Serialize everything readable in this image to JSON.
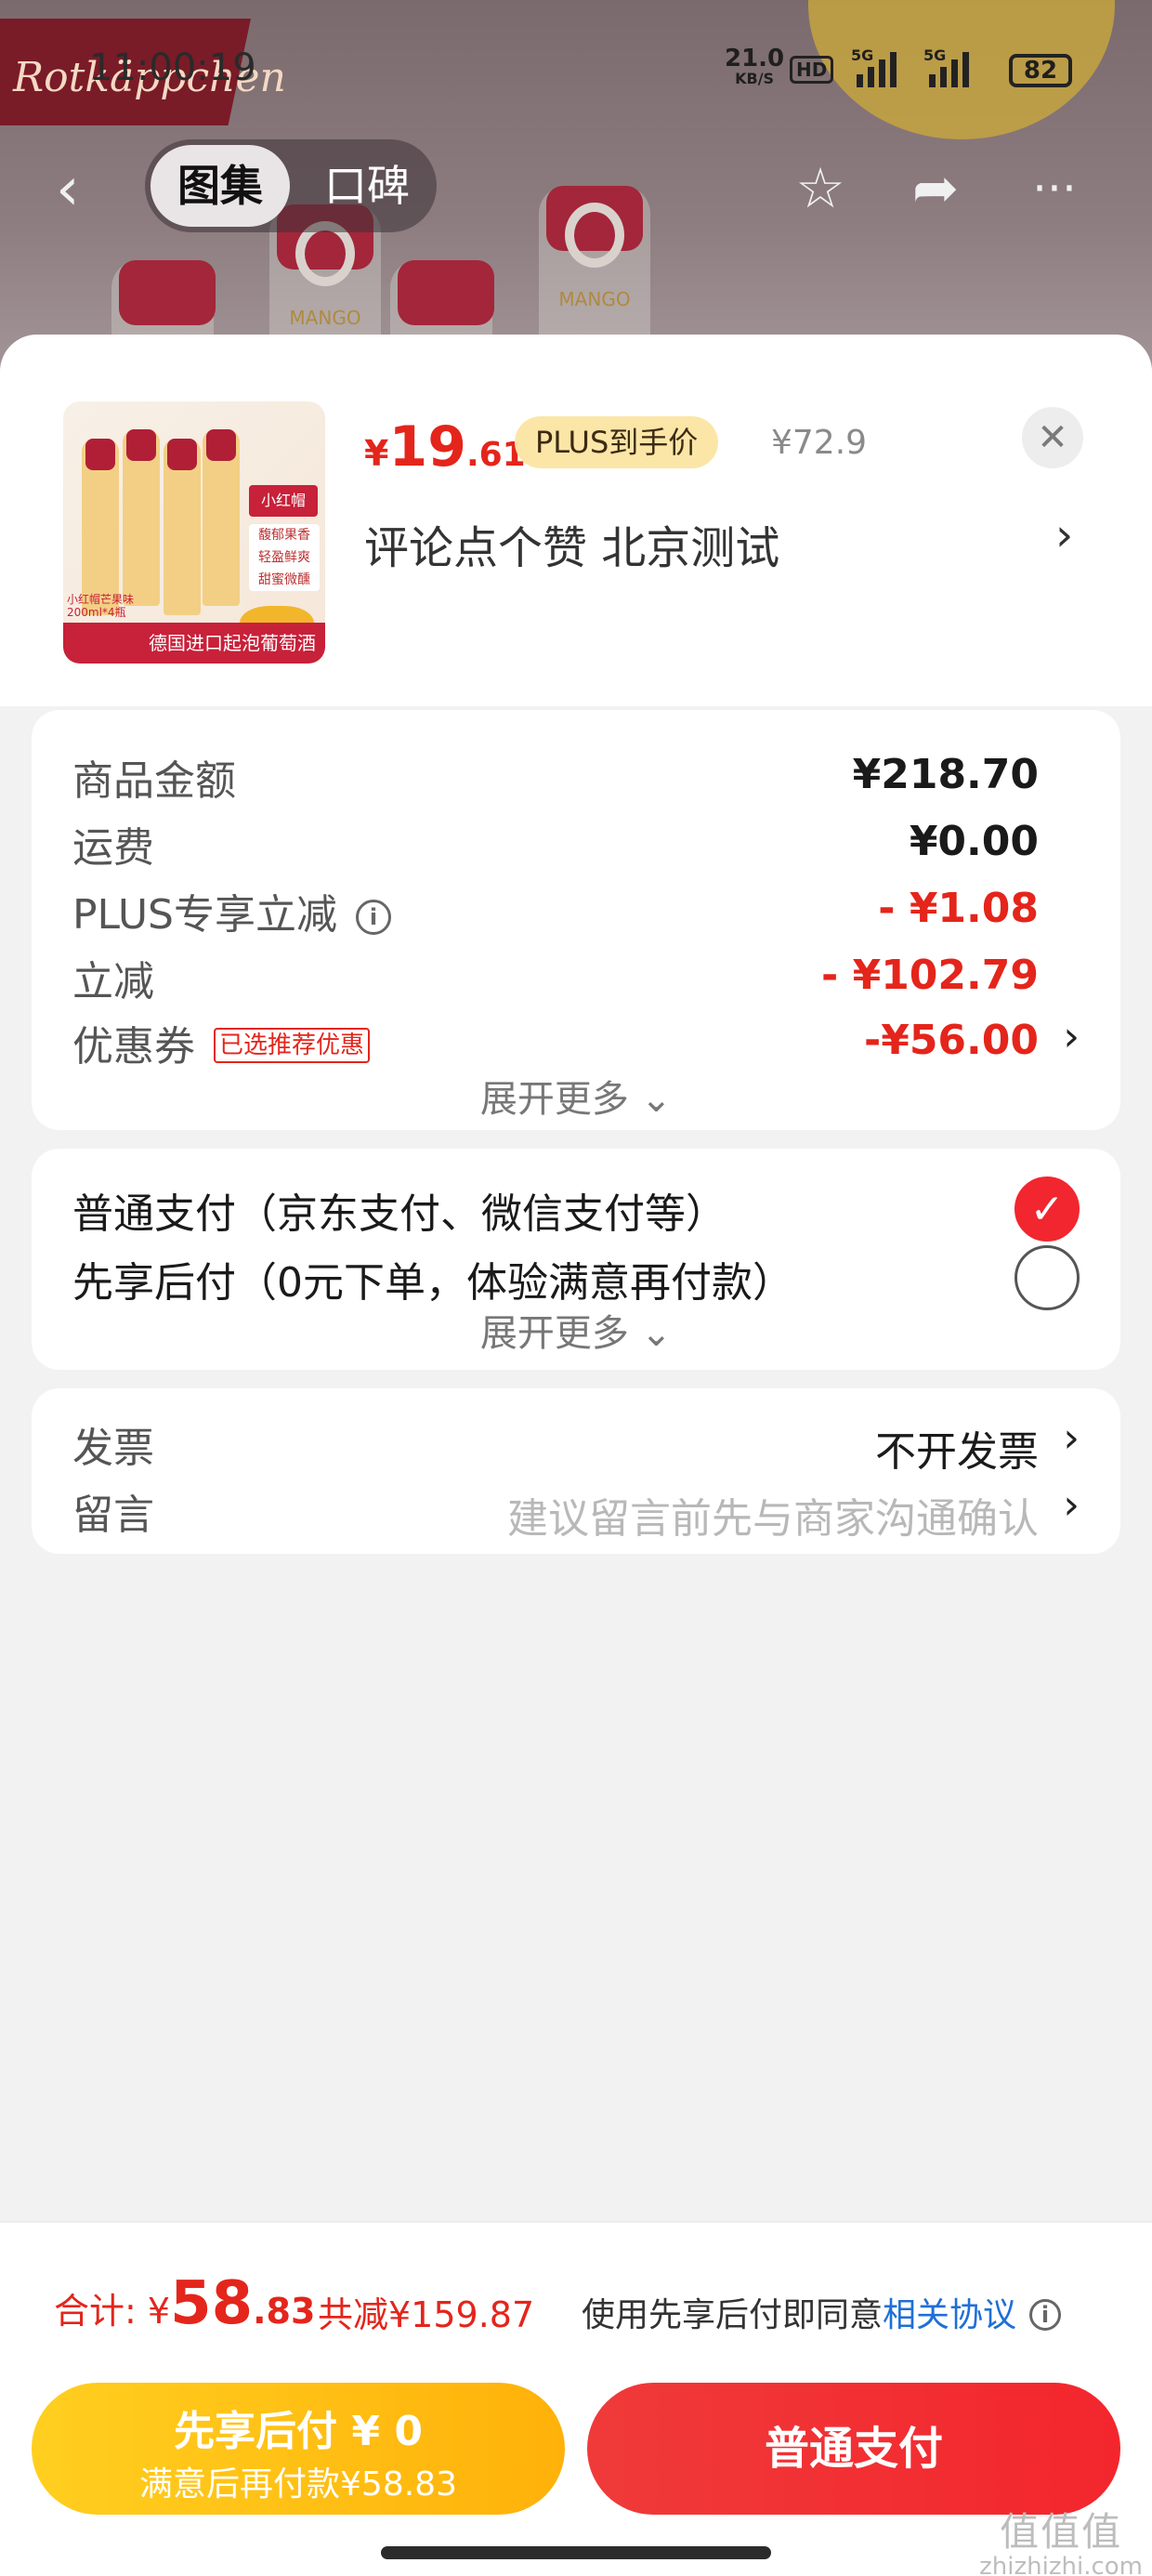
{
  "background": {
    "brand": "Rotkäppchen",
    "bottle_label": "MANGO"
  },
  "status_bar": {
    "time": "11:00:19",
    "net_speed": "21.0",
    "net_unit": "KB/S",
    "hd": "HD",
    "sig1": "5G",
    "sig2": "5G",
    "battery": "82"
  },
  "nav": {
    "tab_gallery": "图集",
    "tab_reviews": "口碑",
    "back_icon": "chevron-left",
    "star_icon": "star-outline",
    "share_icon": "share-arrow",
    "more_icon": "more-dots"
  },
  "product": {
    "price_yen": "¥",
    "price_int": "19",
    "price_dec": ".61",
    "plus_label": "PLUS到手价",
    "original_price": "¥72.9",
    "address": "评论点个赞  北京测试",
    "thumb_band": "德国进口起泡葡萄酒",
    "thumb_tag": "小红帽",
    "thumb_features": [
      "馥郁果香",
      "轻盈鲜爽",
      "甜蜜微醺"
    ],
    "thumb_fine": "小红帽芒果味\n200ml*4瓶"
  },
  "summary": {
    "rows": [
      {
        "label": "商品金额",
        "value": "¥218.70"
      },
      {
        "label": "运费",
        "value": "¥0.00"
      },
      {
        "label": "PLUS专享立减",
        "value": "- ¥1.08"
      },
      {
        "label": "立减",
        "value": "- ¥102.79"
      },
      {
        "label": "优惠券",
        "value": "-¥56.00",
        "tag": "已选推荐优惠"
      }
    ],
    "expand": "展开更多 ⌄"
  },
  "payment": {
    "options": [
      {
        "label": "普通支付（京东支付、微信支付等）",
        "selected": true
      },
      {
        "label": "先享后付（0元下单，体验满意再付款）",
        "selected": false
      }
    ],
    "expand": "展开更多 ⌄"
  },
  "extra": {
    "invoice_label": "发票",
    "invoice_value": "不开发票",
    "note_label": "留言",
    "note_placeholder": "建议留言前先与商家沟通确认"
  },
  "total": {
    "label": "合计: ¥",
    "int": "58",
    "dec": ".83",
    "saved": "共减¥159.87",
    "agree_text": "使用先享后付即同意",
    "agree_link": "相关协议"
  },
  "buttons": {
    "later_title": "先享后付 ¥ 0",
    "later_sub": "满意后再付款¥58.83",
    "normal": "普通支付"
  },
  "watermark": {
    "glyphs": "值值值",
    "domain": "zhizhizhi.com"
  },
  "colors": {
    "accent_red": "#e4251b",
    "pay_yellow": "#ffb10a",
    "link_blue": "#1f6fd6"
  }
}
